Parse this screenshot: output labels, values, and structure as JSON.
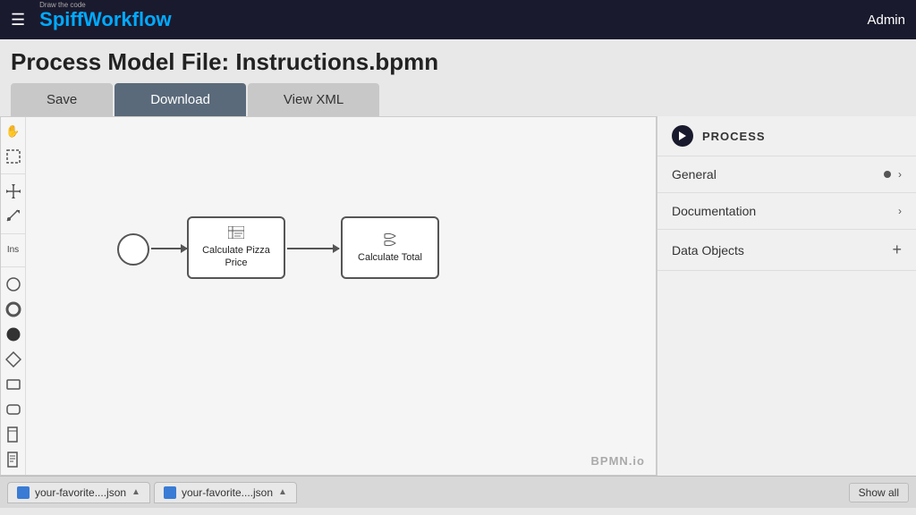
{
  "nav": {
    "hamburger": "☰",
    "logo_prefix": "S",
    "logo_text": "piffWorkflow",
    "logo_tagline": "Draw the code",
    "admin_label": "Admin"
  },
  "page": {
    "title": "Process Model File: Instructions.bpmn"
  },
  "tabs": [
    {
      "id": "save",
      "label": "Save",
      "active": false
    },
    {
      "id": "download",
      "label": "Download",
      "active": true
    },
    {
      "id": "viewxml",
      "label": "View XML",
      "active": false
    }
  ],
  "toolbar": {
    "tools": [
      "✋",
      "⊹",
      "⟺",
      "⟋",
      "Ins"
    ]
  },
  "diagram": {
    "task1_label": "Calculate Pizza\nPrice",
    "task2_label": "Calculate Total",
    "watermark": "BPMN.io"
  },
  "right_panel": {
    "title": "PROCESS",
    "sections": [
      {
        "id": "general",
        "label": "General",
        "has_dot": true,
        "has_chevron": true
      },
      {
        "id": "documentation",
        "label": "Documentation",
        "has_dot": false,
        "has_chevron": true
      },
      {
        "id": "data-objects",
        "label": "Data Objects",
        "has_plus": true
      }
    ]
  },
  "bottom_bar": {
    "tab1_label": "your-favorite....json",
    "tab2_label": "your-favorite....json",
    "show_all_label": "Show all"
  }
}
